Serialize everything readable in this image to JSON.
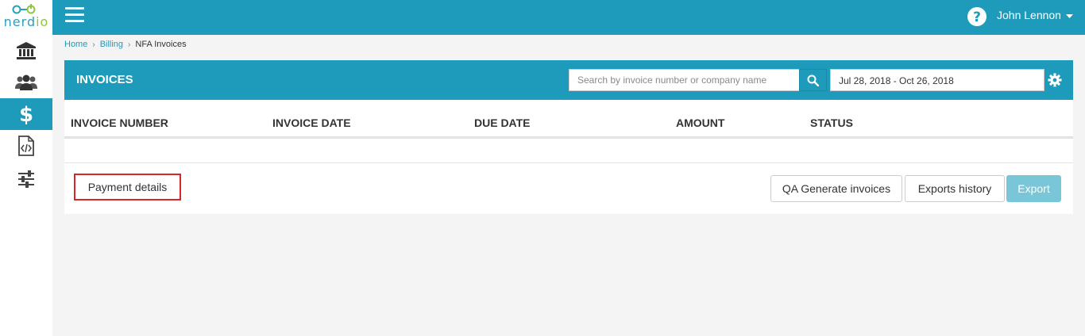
{
  "app": {
    "logo": {
      "text_main": "nerd",
      "text_accent": "io"
    }
  },
  "sidebar": {
    "items": [
      {
        "name": "bank",
        "icon": "bank-icon"
      },
      {
        "name": "users",
        "icon": "users-icon"
      },
      {
        "name": "billing",
        "icon": "dollar-icon",
        "active": true
      },
      {
        "name": "code",
        "icon": "code-file-icon"
      },
      {
        "name": "settings",
        "icon": "sliders-icon"
      }
    ]
  },
  "header": {
    "user_name": "John Lennon",
    "help_icon": "question-circle-icon",
    "menu_icon": "hamburger-icon"
  },
  "breadcrumb": {
    "items": [
      "Home",
      "Billing",
      "NFA Invoices"
    ],
    "separator": "›"
  },
  "panel": {
    "title": "INVOICES",
    "search": {
      "placeholder": "Search by invoice number or company name",
      "value": ""
    },
    "date_range": "Jul 28, 2018 - Oct 26, 2018",
    "columns": [
      "INVOICE NUMBER",
      "INVOICE DATE",
      "DUE DATE",
      "AMOUNT",
      "STATUS"
    ],
    "rows": []
  },
  "actions": {
    "payment_details": "Payment details",
    "qa_generate": "QA Generate invoices",
    "exports_history": "Exports history",
    "export": "Export"
  },
  "colors": {
    "brand": "#1e9bbb",
    "logo_accent": "#8dc63f",
    "highlight_border": "#d9262c",
    "export_disabled": "#79c6d9"
  }
}
